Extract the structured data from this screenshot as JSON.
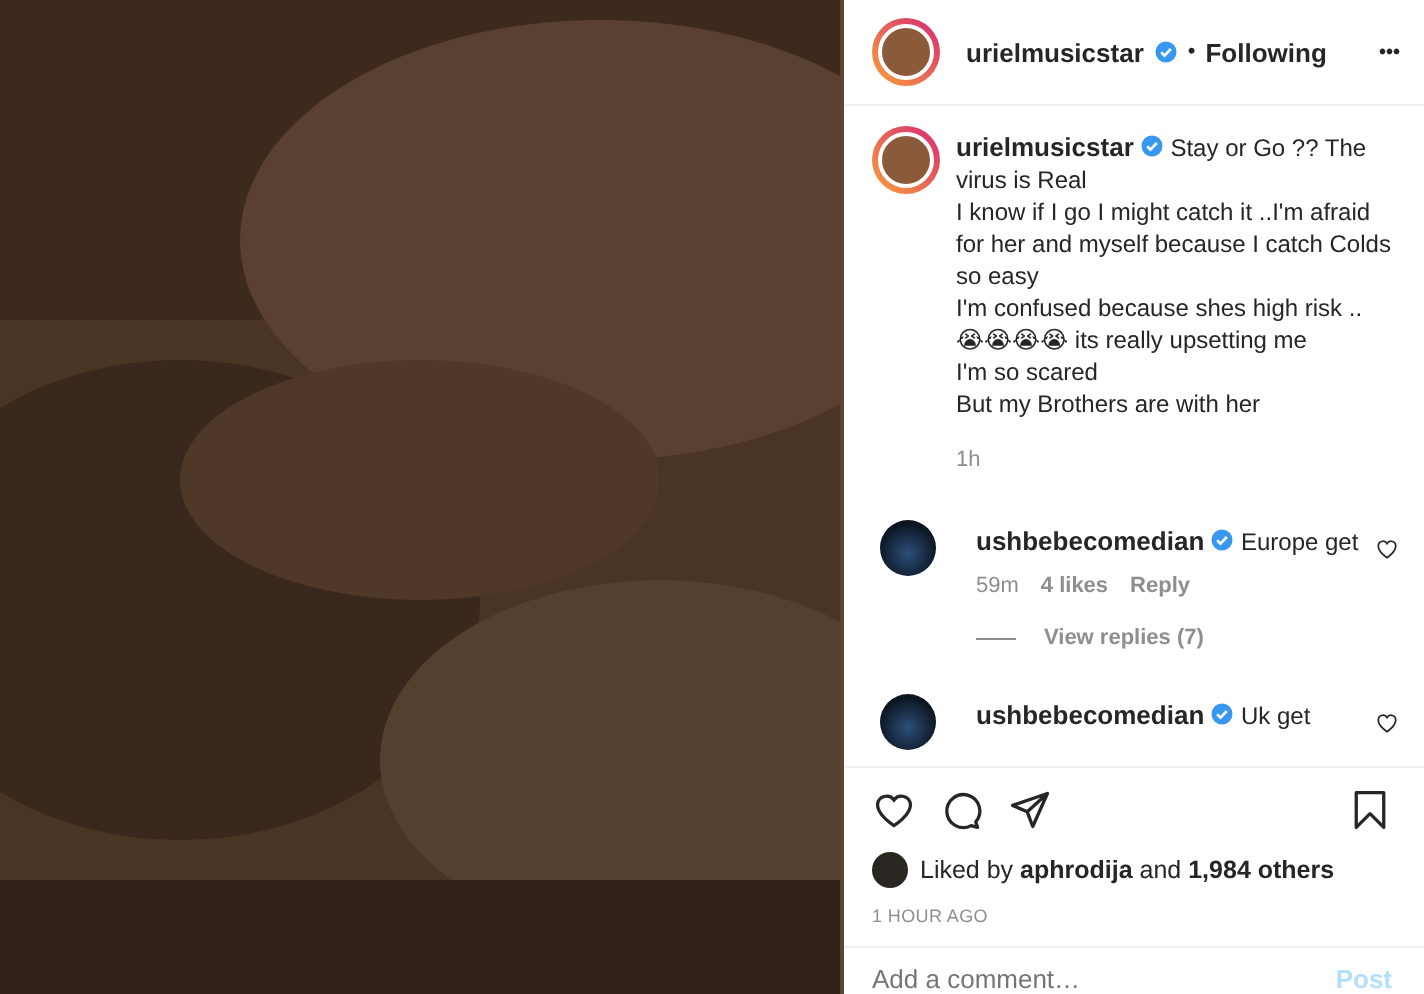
{
  "header": {
    "username": "urielmusicstar",
    "verified": true,
    "separator": "•",
    "follow_status": "Following",
    "more": "•••"
  },
  "caption": {
    "username": "urielmusicstar",
    "verified": true,
    "lines": [
      "Stay or Go ?? The virus is Real",
      "I know if I go I might catch it ..I'm afraid for her and myself because I catch Colds so easy",
      "I'm confused because shes high risk ..",
      "😭😭😭😭 its really upsetting me",
      "I'm so scared",
      "But my Brothers are with her"
    ],
    "time": "1h"
  },
  "comments": [
    {
      "username": "ushbebecomedian",
      "verified": true,
      "text": "Europe get",
      "liked": false,
      "time": "59m",
      "likes": "4 likes",
      "reply": "Reply",
      "view_replies": "View replies (7)"
    },
    {
      "username": "ushbebecomedian",
      "verified": true,
      "text": "Uk get",
      "liked": false
    }
  ],
  "actions": {
    "liked": false,
    "saved": false
  },
  "likes": {
    "prefix": "Liked by",
    "user": "aphrodija",
    "middle": "and",
    "count": "1,984 others"
  },
  "timestamp": "1 HOUR AGO",
  "comment_field": {
    "placeholder": "Add a comment…",
    "post": "Post",
    "post_enabled": false
  }
}
